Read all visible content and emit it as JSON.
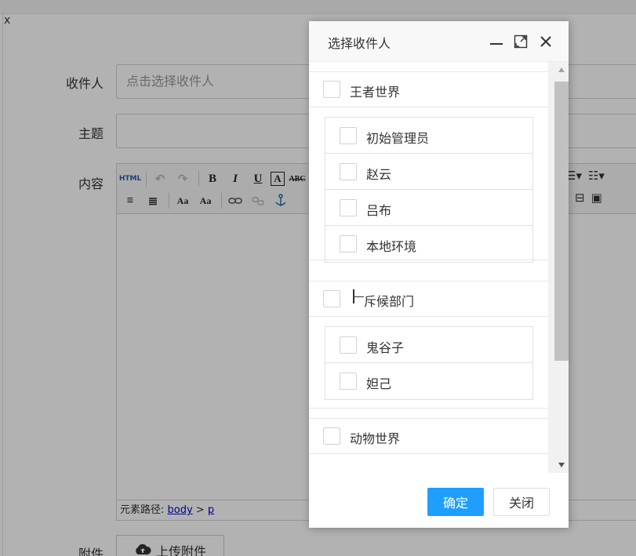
{
  "page": {
    "close_label": "x",
    "form": {
      "recipient_label": "收件人",
      "recipient_placeholder": "点击选择收件人",
      "subject_label": "主题",
      "content_label": "内容",
      "attachment_label": "附件",
      "upload_label": "上传附件"
    },
    "editor": {
      "status_prefix": "元素路径: ",
      "status_body": "body",
      "status_sep": " > ",
      "status_p": "p",
      "toolbar_row1": [
        "HTML",
        "↶",
        "↷",
        "B",
        "I",
        "U",
        "A",
        "ABC"
      ],
      "toolbar_row2": [
        "≡",
        "≣",
        "Aa",
        "Aa",
        "link",
        "unlink",
        "anchor"
      ]
    }
  },
  "modal": {
    "title": "选择收件人",
    "groups": [
      {
        "label": "王者世界",
        "members": [
          "初始管理员",
          "赵云",
          "吕布",
          "本地环境"
        ]
      },
      {
        "label": "斥候部门",
        "members": [
          "鬼谷子",
          "妲己"
        ]
      },
      {
        "label": "动物世界",
        "members": []
      }
    ],
    "ok_label": "确定",
    "close_label": "关闭"
  },
  "colors": {
    "primary": "#1e9fff",
    "shade": "rgba(0,0,0,0.3)"
  }
}
